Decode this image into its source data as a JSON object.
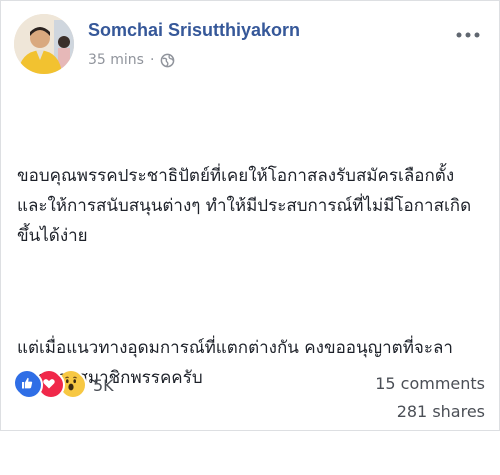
{
  "post": {
    "author_name": "Somchai Srisutthiyakorn",
    "timestamp": "35 mins",
    "separator": "·",
    "privacy_icon": "globe-icon",
    "paragraphs": [
      "ขอบคุณพรรคประชาธิปัตย์ที่เคยให้โอกาสลงรับสมัครเลือกตั้ง และให้การสนับสนุนต่างๆ ทำให้มีประสบการณ์ที่ไม่มีโอกาสเกิดขึ้นได้ง่าย",
      "แต่เมื่อแนวทางอุดมการณ์ที่แตกต่างกัน คงขออนุญาตที่จะลาออกจากสมาชิกพรรคครับ"
    ]
  },
  "engagement": {
    "reaction_icons": [
      "like-icon",
      "love-icon",
      "wow-icon"
    ],
    "reaction_count": "5K",
    "comments": "15 comments",
    "shares": "281 shares"
  },
  "colors": {
    "author": "#365899",
    "meta": "#90949c",
    "like": "#2f6ee6",
    "love": "#f0284a",
    "wow": "#f7c843"
  }
}
